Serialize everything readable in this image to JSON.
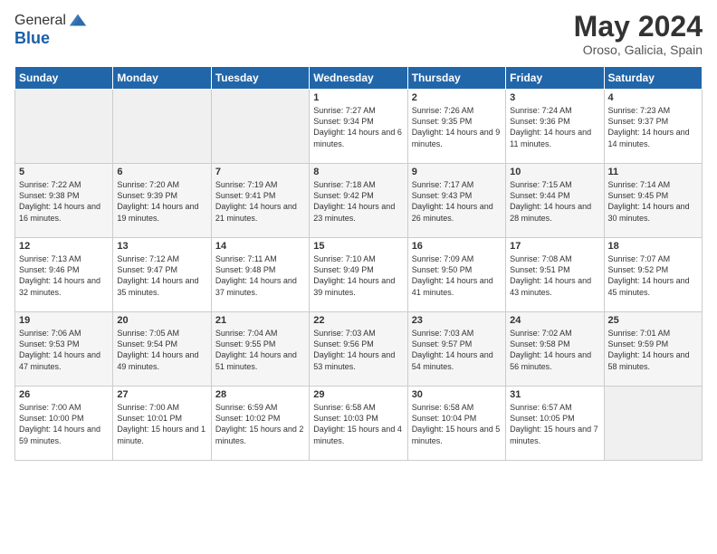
{
  "logo": {
    "general": "General",
    "blue": "Blue"
  },
  "header": {
    "month_year": "May 2024",
    "location": "Oroso, Galicia, Spain"
  },
  "weekdays": [
    "Sunday",
    "Monday",
    "Tuesday",
    "Wednesday",
    "Thursday",
    "Friday",
    "Saturday"
  ],
  "weeks": [
    [
      {
        "day": "",
        "sunrise": "",
        "sunset": "",
        "daylight": ""
      },
      {
        "day": "",
        "sunrise": "",
        "sunset": "",
        "daylight": ""
      },
      {
        "day": "",
        "sunrise": "",
        "sunset": "",
        "daylight": ""
      },
      {
        "day": "1",
        "sunrise": "Sunrise: 7:27 AM",
        "sunset": "Sunset: 9:34 PM",
        "daylight": "Daylight: 14 hours and 6 minutes."
      },
      {
        "day": "2",
        "sunrise": "Sunrise: 7:26 AM",
        "sunset": "Sunset: 9:35 PM",
        "daylight": "Daylight: 14 hours and 9 minutes."
      },
      {
        "day": "3",
        "sunrise": "Sunrise: 7:24 AM",
        "sunset": "Sunset: 9:36 PM",
        "daylight": "Daylight: 14 hours and 11 minutes."
      },
      {
        "day": "4",
        "sunrise": "Sunrise: 7:23 AM",
        "sunset": "Sunset: 9:37 PM",
        "daylight": "Daylight: 14 hours and 14 minutes."
      }
    ],
    [
      {
        "day": "5",
        "sunrise": "Sunrise: 7:22 AM",
        "sunset": "Sunset: 9:38 PM",
        "daylight": "Daylight: 14 hours and 16 minutes."
      },
      {
        "day": "6",
        "sunrise": "Sunrise: 7:20 AM",
        "sunset": "Sunset: 9:39 PM",
        "daylight": "Daylight: 14 hours and 19 minutes."
      },
      {
        "day": "7",
        "sunrise": "Sunrise: 7:19 AM",
        "sunset": "Sunset: 9:41 PM",
        "daylight": "Daylight: 14 hours and 21 minutes."
      },
      {
        "day": "8",
        "sunrise": "Sunrise: 7:18 AM",
        "sunset": "Sunset: 9:42 PM",
        "daylight": "Daylight: 14 hours and 23 minutes."
      },
      {
        "day": "9",
        "sunrise": "Sunrise: 7:17 AM",
        "sunset": "Sunset: 9:43 PM",
        "daylight": "Daylight: 14 hours and 26 minutes."
      },
      {
        "day": "10",
        "sunrise": "Sunrise: 7:15 AM",
        "sunset": "Sunset: 9:44 PM",
        "daylight": "Daylight: 14 hours and 28 minutes."
      },
      {
        "day": "11",
        "sunrise": "Sunrise: 7:14 AM",
        "sunset": "Sunset: 9:45 PM",
        "daylight": "Daylight: 14 hours and 30 minutes."
      }
    ],
    [
      {
        "day": "12",
        "sunrise": "Sunrise: 7:13 AM",
        "sunset": "Sunset: 9:46 PM",
        "daylight": "Daylight: 14 hours and 32 minutes."
      },
      {
        "day": "13",
        "sunrise": "Sunrise: 7:12 AM",
        "sunset": "Sunset: 9:47 PM",
        "daylight": "Daylight: 14 hours and 35 minutes."
      },
      {
        "day": "14",
        "sunrise": "Sunrise: 7:11 AM",
        "sunset": "Sunset: 9:48 PM",
        "daylight": "Daylight: 14 hours and 37 minutes."
      },
      {
        "day": "15",
        "sunrise": "Sunrise: 7:10 AM",
        "sunset": "Sunset: 9:49 PM",
        "daylight": "Daylight: 14 hours and 39 minutes."
      },
      {
        "day": "16",
        "sunrise": "Sunrise: 7:09 AM",
        "sunset": "Sunset: 9:50 PM",
        "daylight": "Daylight: 14 hours and 41 minutes."
      },
      {
        "day": "17",
        "sunrise": "Sunrise: 7:08 AM",
        "sunset": "Sunset: 9:51 PM",
        "daylight": "Daylight: 14 hours and 43 minutes."
      },
      {
        "day": "18",
        "sunrise": "Sunrise: 7:07 AM",
        "sunset": "Sunset: 9:52 PM",
        "daylight": "Daylight: 14 hours and 45 minutes."
      }
    ],
    [
      {
        "day": "19",
        "sunrise": "Sunrise: 7:06 AM",
        "sunset": "Sunset: 9:53 PM",
        "daylight": "Daylight: 14 hours and 47 minutes."
      },
      {
        "day": "20",
        "sunrise": "Sunrise: 7:05 AM",
        "sunset": "Sunset: 9:54 PM",
        "daylight": "Daylight: 14 hours and 49 minutes."
      },
      {
        "day": "21",
        "sunrise": "Sunrise: 7:04 AM",
        "sunset": "Sunset: 9:55 PM",
        "daylight": "Daylight: 14 hours and 51 minutes."
      },
      {
        "day": "22",
        "sunrise": "Sunrise: 7:03 AM",
        "sunset": "Sunset: 9:56 PM",
        "daylight": "Daylight: 14 hours and 53 minutes."
      },
      {
        "day": "23",
        "sunrise": "Sunrise: 7:03 AM",
        "sunset": "Sunset: 9:57 PM",
        "daylight": "Daylight: 14 hours and 54 minutes."
      },
      {
        "day": "24",
        "sunrise": "Sunrise: 7:02 AM",
        "sunset": "Sunset: 9:58 PM",
        "daylight": "Daylight: 14 hours and 56 minutes."
      },
      {
        "day": "25",
        "sunrise": "Sunrise: 7:01 AM",
        "sunset": "Sunset: 9:59 PM",
        "daylight": "Daylight: 14 hours and 58 minutes."
      }
    ],
    [
      {
        "day": "26",
        "sunrise": "Sunrise: 7:00 AM",
        "sunset": "Sunset: 10:00 PM",
        "daylight": "Daylight: 14 hours and 59 minutes."
      },
      {
        "day": "27",
        "sunrise": "Sunrise: 7:00 AM",
        "sunset": "Sunset: 10:01 PM",
        "daylight": "Daylight: 15 hours and 1 minute."
      },
      {
        "day": "28",
        "sunrise": "Sunrise: 6:59 AM",
        "sunset": "Sunset: 10:02 PM",
        "daylight": "Daylight: 15 hours and 2 minutes."
      },
      {
        "day": "29",
        "sunrise": "Sunrise: 6:58 AM",
        "sunset": "Sunset: 10:03 PM",
        "daylight": "Daylight: 15 hours and 4 minutes."
      },
      {
        "day": "30",
        "sunrise": "Sunrise: 6:58 AM",
        "sunset": "Sunset: 10:04 PM",
        "daylight": "Daylight: 15 hours and 5 minutes."
      },
      {
        "day": "31",
        "sunrise": "Sunrise: 6:57 AM",
        "sunset": "Sunset: 10:05 PM",
        "daylight": "Daylight: 15 hours and 7 minutes."
      },
      {
        "day": "",
        "sunrise": "",
        "sunset": "",
        "daylight": ""
      }
    ]
  ]
}
